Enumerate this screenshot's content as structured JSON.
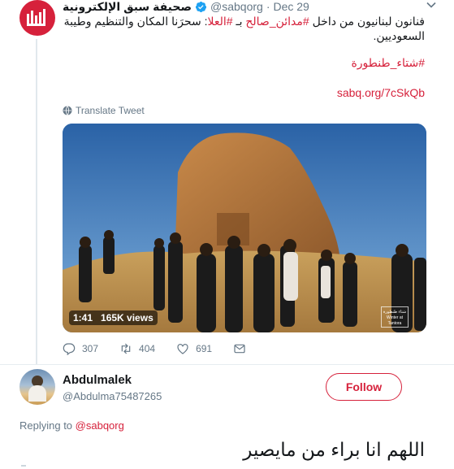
{
  "tweet": {
    "author_name": "صحيفة سبق الإلكترونية",
    "handle": "@sabqorg",
    "separator": "·",
    "date": "Dec 29",
    "text_part1": "فنانون لبنانيون من داخل ",
    "tag1": "#مدائن_صالح",
    "text_part2": " بـ ",
    "tag2": "#العلا",
    "text_part3": ": سحرَنا المكان والتنظيم وطيبة السعوديين.",
    "hashtag": "#شتاء_طنطورة",
    "link": "sabq.org/7cSkQb",
    "translate_label": "Translate Tweet",
    "video": {
      "duration": "1:41",
      "views": "165K views",
      "watermark": "شتاء طنطورة Winter at Tantora"
    },
    "actions": {
      "replies": "307",
      "retweets": "404",
      "likes": "691"
    }
  },
  "reply": {
    "author_name": "Abdulmalek",
    "handle": "@Abdulma75487265",
    "follow_label": "Follow",
    "replying_prefix": "Replying to ",
    "replying_to": "@sabqorg",
    "text": "اللهم انا براء من مايصير"
  },
  "colors": {
    "accent": "#d6213b",
    "secondary_text": "#657786",
    "primary_text": "#14171a",
    "verified": "#1da1f2"
  },
  "icons": [
    "sabq-logo-icon",
    "verified-icon",
    "chevron-down-icon",
    "globe-icon",
    "reply-icon",
    "retweet-icon",
    "like-icon",
    "message-icon"
  ]
}
